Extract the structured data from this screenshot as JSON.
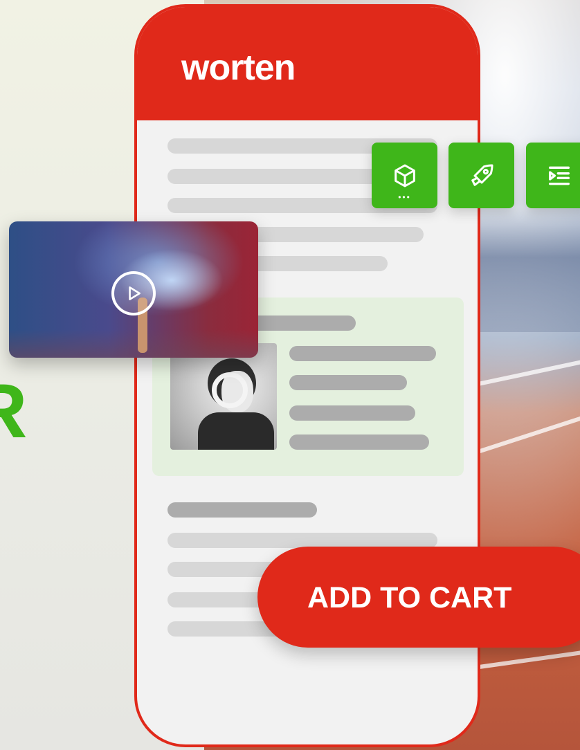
{
  "brand": {
    "logo_text": "worten",
    "primary_color": "#e0291a",
    "accent_color": "#3fb61a"
  },
  "background": {
    "partial_heading_text": "R"
  },
  "feature_icons": [
    {
      "name": "3d-box-icon"
    },
    {
      "name": "rocket-icon"
    },
    {
      "name": "text-indent-icon"
    }
  ],
  "video": {
    "play_icon": "play-circle-icon"
  },
  "cta": {
    "label": "ADD TO CART"
  }
}
